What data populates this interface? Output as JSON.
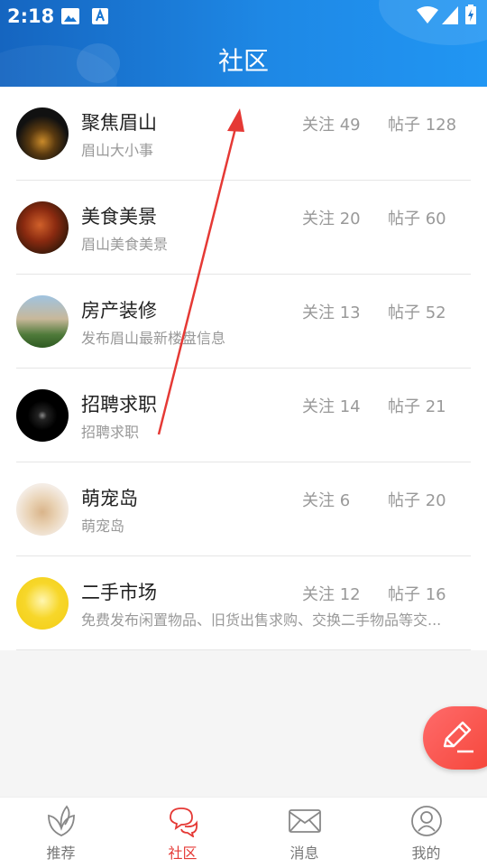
{
  "status_bar": {
    "time": "2:18"
  },
  "header": {
    "title": "社区"
  },
  "communities": [
    {
      "name": "聚焦眉山",
      "desc": "眉山大小事",
      "follow": "关注 49",
      "posts": "帖子 128"
    },
    {
      "name": "美食美景",
      "desc": "眉山美食美景",
      "follow": "关注 20",
      "posts": "帖子 60"
    },
    {
      "name": "房产装修",
      "desc": "发布眉山最新楼盘信息",
      "follow": "关注 13",
      "posts": "帖子 52"
    },
    {
      "name": "招聘求职",
      "desc": "招聘求职",
      "follow": "关注 14",
      "posts": "帖子 21"
    },
    {
      "name": "萌宠岛",
      "desc": "萌宠岛",
      "follow": "关注 6",
      "posts": "帖子 20"
    },
    {
      "name": "二手市场",
      "desc": "免费发布闲置物品、旧货出售求购、交换二手物品等交...",
      "follow": "关注 12",
      "posts": "帖子 16"
    }
  ],
  "tabs": [
    {
      "label": "推荐",
      "icon": "leaf-icon"
    },
    {
      "label": "社区",
      "icon": "chat-bubbles-icon",
      "active": true
    },
    {
      "label": "消息",
      "icon": "envelope-icon"
    },
    {
      "label": "我的",
      "icon": "user-icon"
    }
  ],
  "colors": {
    "header": "#1e88e5",
    "accent": "#e53935",
    "fab": "#f44336",
    "annotation_arrow": "#e53935"
  }
}
